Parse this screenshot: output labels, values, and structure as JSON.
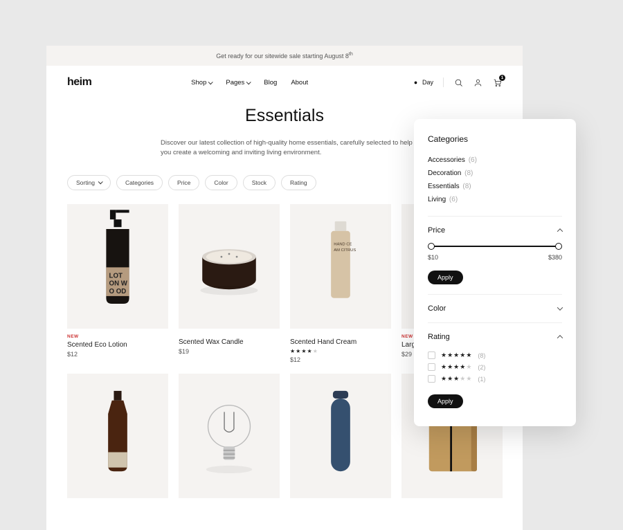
{
  "announcement": {
    "prefix": "Get ready for our sitewide sale starting August 8",
    "suffix": "th"
  },
  "logo": "heim",
  "nav": {
    "shop": "Shop",
    "pages": "Pages",
    "blog": "Blog",
    "about": "About"
  },
  "header": {
    "day_label": "Day",
    "cart_count": "1"
  },
  "page": {
    "title": "Essentials",
    "description": "Discover our latest collection of high-quality home essentials, carefully selected to help you create a welcoming and inviting living environment."
  },
  "filter_pills": {
    "sorting": "Sorting",
    "categories": "Categories",
    "price": "Price",
    "color": "Color",
    "stock": "Stock",
    "rating": "Rating"
  },
  "products": [
    {
      "badge": "NEW",
      "title": "Scented Eco Lotion",
      "price": "$12",
      "rating": null
    },
    {
      "badge": null,
      "title": "Scented Wax Candle",
      "price": "$19",
      "rating": null
    },
    {
      "badge": null,
      "title": "Scented Hand Cream",
      "price": "$12",
      "rating": 4
    },
    {
      "badge": "NEW",
      "title": "Larg",
      "price": "$29",
      "rating": null
    }
  ],
  "panel": {
    "categories_heading": "Categories",
    "categories": [
      {
        "label": "Accessories",
        "count": "(6)",
        "active": false
      },
      {
        "label": "Decoration",
        "count": "(8)",
        "active": false
      },
      {
        "label": "Essentials",
        "count": "(8)",
        "active": true
      },
      {
        "label": "Living",
        "count": "(6)",
        "active": false
      }
    ],
    "price_heading": "Price",
    "price_min": "$10",
    "price_max": "$380",
    "apply_label": "Apply",
    "color_heading": "Color",
    "rating_heading": "Rating",
    "ratings": [
      {
        "stars": 5,
        "count": "(8)"
      },
      {
        "stars": 4,
        "count": "(2)"
      },
      {
        "stars": 3,
        "count": "(1)"
      }
    ]
  }
}
